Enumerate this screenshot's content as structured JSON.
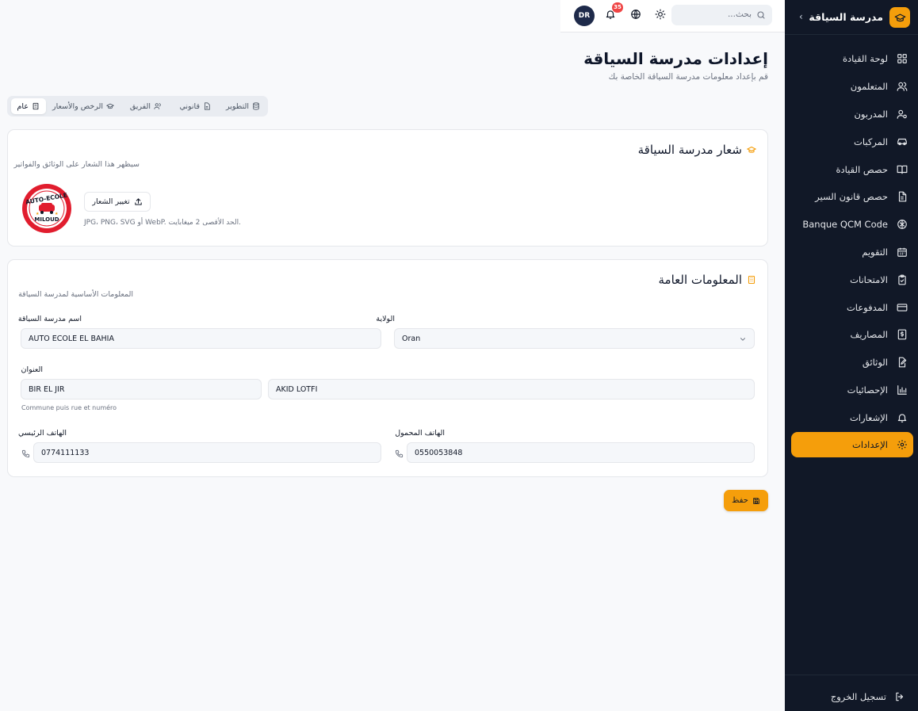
{
  "app": {
    "name": "مدرسة السياقة",
    "collapse_icon": "chevron-left-icon"
  },
  "topbar": {
    "search_placeholder": "بحث...",
    "notifications_count": "35",
    "avatar_initials": "DR"
  },
  "sidebar": {
    "items": [
      {
        "label": "لوحة القيادة",
        "icon": "dashboard-icon"
      },
      {
        "label": "المتعلمون",
        "icon": "users-icon"
      },
      {
        "label": "المدربون",
        "icon": "user-cog-icon"
      },
      {
        "label": "المركبات",
        "icon": "car-icon"
      },
      {
        "label": "حصص القيادة",
        "icon": "book-open-icon"
      },
      {
        "label": "حصص قانون السير",
        "icon": "file-text-icon"
      },
      {
        "label": "Banque QCM Code",
        "icon": "brain-icon"
      },
      {
        "label": "التقويم",
        "icon": "calendar-icon"
      },
      {
        "label": "الامتحانات",
        "icon": "clipboard-check-icon"
      },
      {
        "label": "المدفوعات",
        "icon": "credit-card-icon"
      },
      {
        "label": "المصاريف",
        "icon": "receipt-icon"
      },
      {
        "label": "الوثائق",
        "icon": "file-edit-icon"
      },
      {
        "label": "الإحصائيات",
        "icon": "bar-chart-icon"
      },
      {
        "label": "الإشعارات",
        "icon": "bell-icon"
      },
      {
        "label": "الإعدادات",
        "icon": "settings-icon",
        "active": true
      }
    ],
    "logout_label": "تسجيل الخروج"
  },
  "header": {
    "title": "إعدادات مدرسة السياقة",
    "subtitle": "قم بإعداد معلومات مدرسة السياقة الخاصة بك"
  },
  "tabs": [
    {
      "label": "عام",
      "active": true
    },
    {
      "label": "الرخص والأسعار"
    },
    {
      "label": "الفريق"
    },
    {
      "label": "قانوني"
    },
    {
      "label": "التطوير"
    }
  ],
  "logo_card": {
    "title": "شعار مدرسة السياقة",
    "subtitle": "سيظهر هذا الشعار على الوثائق والفواتير",
    "logo_text_top": "AUTO-ECOLE",
    "logo_text_bottom": "MILOUD",
    "change_button": "تغيير الشعار",
    "hint": "JPG، PNG، SVG أو WebP. الحد الأقصى 2 ميغابايت."
  },
  "info_card": {
    "title": "المعلومات العامة",
    "subtitle": "المعلومات الأساسية لمدرسة السياقة",
    "school_name_label": "اسم مدرسة السياقة",
    "school_name_value": "AUTO ECOLE EL BAHIA",
    "wilaya_label": "الولاية",
    "wilaya_value": "Oran",
    "address_label": "العنوان",
    "address_commune": "BIR EL JIR",
    "address_street": "AKID LOTFI",
    "address_hint": "Commune puis rue et numéro",
    "phone_main_label": "الهاتف الرئيسي",
    "phone_main_value": "0774111133",
    "phone_mobile_label": "الهاتف المحمول",
    "phone_mobile_value": "0550053848"
  },
  "save_button": "حفظ",
  "colors": {
    "accent": "#f59e0b",
    "sidebar_bg": "#111827",
    "badge": "#ef4444"
  }
}
